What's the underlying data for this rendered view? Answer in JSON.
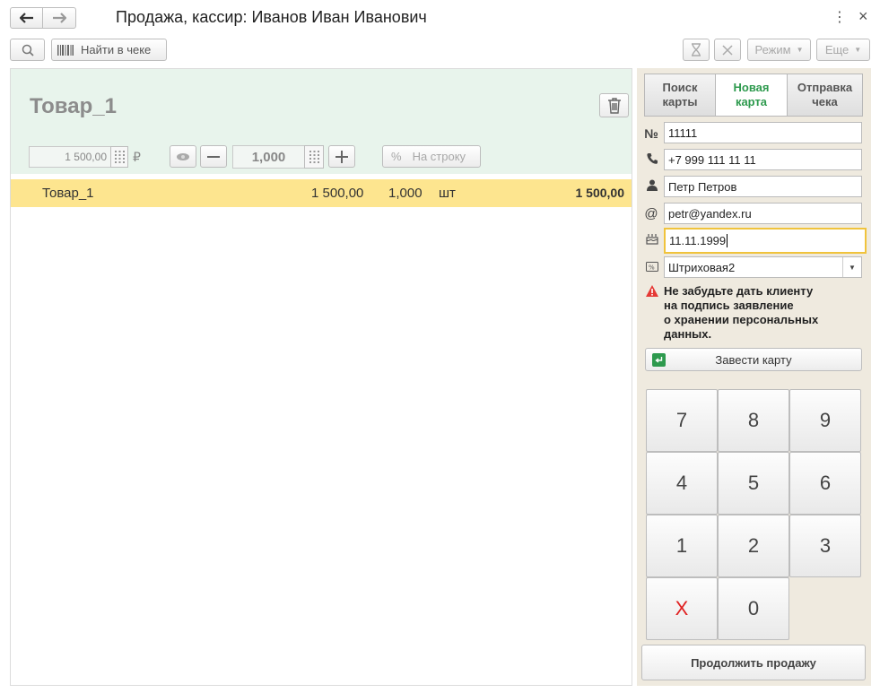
{
  "window": {
    "title": "Продажа, кассир: Иванов Иван Иванович",
    "more_icon": "⋮",
    "close_icon": "×"
  },
  "toolbar": {
    "search_in_receipt": "Найти в чеке",
    "mode": "Режим",
    "more": "Еще"
  },
  "product": {
    "title": "Товар_1",
    "price": "1 500,00",
    "currency": "₽",
    "quantity": "1,000",
    "discount_placeholder": "На строку",
    "percent": "%"
  },
  "receipt": {
    "rows": [
      {
        "name": "Товар_1",
        "price": "1 500,00",
        "qty": "1,000",
        "unit": "шт",
        "sum": "1 500,00"
      }
    ]
  },
  "card_panel": {
    "tabs": [
      {
        "label": "Поиск карты",
        "line1": "Поиск",
        "line2": "карты",
        "active": false
      },
      {
        "label": "Новая карта",
        "line1": "Новая",
        "line2": "карта",
        "active": true
      },
      {
        "label": "Отправка чека",
        "line1": "Отправка",
        "line2": "чека",
        "active": false
      }
    ],
    "number_label": "№",
    "number": "11111",
    "phone": "+7 999 111 11 11",
    "name": "Петр Петров",
    "email_label": "@",
    "email": "petr@yandex.ru",
    "birthday": "11.11.1999",
    "card_type": "Штриховая2",
    "warning": "Не забудьте дать клиенту на подпись заявление о хранении персональных данных.",
    "warning_lines": [
      "Не забудьте дать клиенту",
      "на подпись заявление",
      "о хранении персональных",
      "данных."
    ],
    "create_card": "Завести карту",
    "continue": "Продолжить продажу"
  },
  "numpad": {
    "keys": [
      "7",
      "8",
      "9",
      "4",
      "5",
      "6",
      "1",
      "2",
      "3",
      "X",
      "0"
    ]
  },
  "colors": {
    "accent_green": "#2e9a4e",
    "row_highlight": "#fde58f",
    "product_area": "#e8f4ec",
    "side_panel": "#efeadf",
    "focus": "#f0c33c",
    "warning_red": "#e53935",
    "clear_red": "#e02020"
  }
}
